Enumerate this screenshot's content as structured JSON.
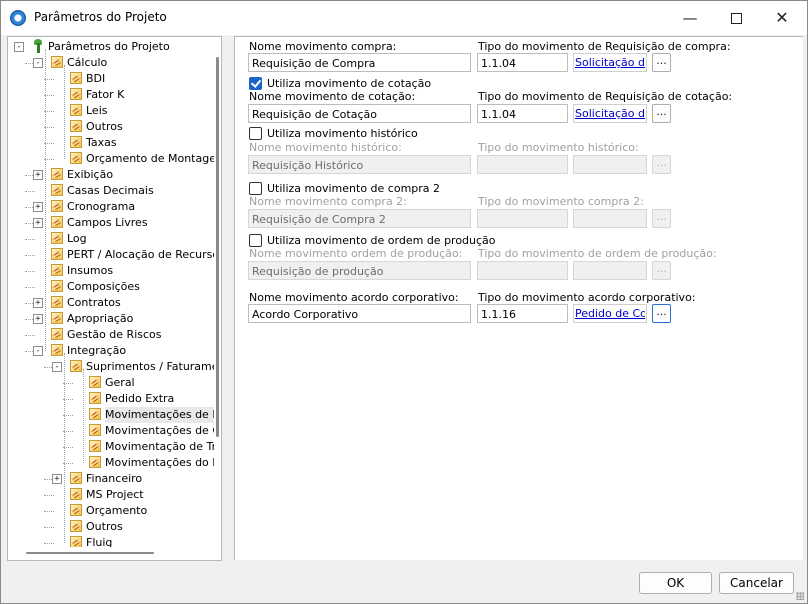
{
  "window": {
    "title": "Parâmetros do Projeto",
    "minimize": "—",
    "close": "✕"
  },
  "tree": {
    "items": [
      {
        "label": "Parâmetros do Projeto",
        "level": 0,
        "expander": "-",
        "icon": "root-icon"
      },
      {
        "label": "Cálculo",
        "level": 1,
        "expander": "-",
        "icon": "folder-icon"
      },
      {
        "label": "BDI",
        "level": 2,
        "expander": "",
        "icon": "folder-icon"
      },
      {
        "label": "Fator K",
        "level": 2,
        "expander": "",
        "icon": "folder-icon"
      },
      {
        "label": "Leis",
        "level": 2,
        "expander": "",
        "icon": "folder-icon"
      },
      {
        "label": "Outros",
        "level": 2,
        "expander": "",
        "icon": "folder-icon"
      },
      {
        "label": "Taxas",
        "level": 2,
        "expander": "",
        "icon": "folder-icon"
      },
      {
        "label": "Orçamento de Montagem",
        "level": 2,
        "expander": "",
        "icon": "folder-icon"
      },
      {
        "label": "Exibição",
        "level": 1,
        "expander": "+",
        "icon": "folder-icon"
      },
      {
        "label": "Casas Decimais",
        "level": 1,
        "expander": "",
        "icon": "folder-icon"
      },
      {
        "label": "Cronograma",
        "level": 1,
        "expander": "+",
        "icon": "folder-icon"
      },
      {
        "label": "Campos Livres",
        "level": 1,
        "expander": "+",
        "icon": "folder-icon"
      },
      {
        "label": "Log",
        "level": 1,
        "expander": "",
        "icon": "folder-icon"
      },
      {
        "label": "PERT / Alocação de Recursos",
        "level": 1,
        "expander": "",
        "icon": "folder-icon"
      },
      {
        "label": "Insumos",
        "level": 1,
        "expander": "",
        "icon": "folder-icon"
      },
      {
        "label": "Composições",
        "level": 1,
        "expander": "",
        "icon": "folder-icon"
      },
      {
        "label": "Contratos",
        "level": 1,
        "expander": "+",
        "icon": "folder-icon"
      },
      {
        "label": "Apropriação",
        "level": 1,
        "expander": "+",
        "icon": "folder-icon"
      },
      {
        "label": "Gestão de Riscos",
        "level": 1,
        "expander": "",
        "icon": "folder-icon"
      },
      {
        "label": "Integração",
        "level": 1,
        "expander": "-",
        "icon": "folder-icon"
      },
      {
        "label": "Suprimentos / Faturamento",
        "level": 2,
        "expander": "-",
        "icon": "folder-icon"
      },
      {
        "label": "Geral",
        "level": 3,
        "expander": "",
        "icon": "folder-icon"
      },
      {
        "label": "Pedido Extra",
        "level": 3,
        "expander": "",
        "icon": "folder-icon"
      },
      {
        "label": "Movimentações de Pedidos",
        "level": 3,
        "expander": "",
        "icon": "folder-icon",
        "selected": true
      },
      {
        "label": "Movimentações de Compras",
        "level": 3,
        "expander": "",
        "icon": "folder-icon"
      },
      {
        "label": "Movimentação de Transferência",
        "level": 3,
        "expander": "",
        "icon": "folder-icon"
      },
      {
        "label": "Movimentações do Bem",
        "level": 3,
        "expander": "",
        "icon": "folder-icon"
      },
      {
        "label": "Financeiro",
        "level": 2,
        "expander": "+",
        "icon": "folder-icon"
      },
      {
        "label": "MS Project",
        "level": 2,
        "expander": "",
        "icon": "folder-icon"
      },
      {
        "label": "Orçamento",
        "level": 2,
        "expander": "",
        "icon": "folder-icon"
      },
      {
        "label": "Outros",
        "level": 2,
        "expander": "",
        "icon": "folder-icon"
      },
      {
        "label": "Fluig",
        "level": 2,
        "expander": "",
        "icon": "folder-icon"
      }
    ]
  },
  "form": {
    "ellipsis": "...",
    "compra": {
      "name_label": "Nome movimento compra:",
      "name_value": "Requisição de Compra",
      "type_label": "Tipo do movimento de Requisição de compra:",
      "type_value": "1.1.04",
      "type_link": "Solicitação de Compra"
    },
    "cotacao": {
      "check_label": "Utiliza movimento de cotação",
      "checked": true,
      "name_label": "Nome movimento de cotação:",
      "name_value": "Requisição de Cotação",
      "type_label": "Tipo do movimento de Requisição de cotação:",
      "type_value": "1.1.04",
      "type_link": "Solicitação de Compra"
    },
    "historico": {
      "check_label": "Utiliza movimento histórico",
      "checked": false,
      "name_label": "Nome movimento histórico:",
      "name_value": "Requisição Histórico",
      "type_label": "Tipo do movimento histórico:",
      "type_value": "",
      "type_link": ""
    },
    "compra2": {
      "check_label": "Utiliza movimento de compra 2",
      "checked": false,
      "name_label": "Nome movimento compra 2:",
      "name_value": "Requisição de Compra 2",
      "type_label": "Tipo do movimento compra 2:",
      "type_value": "",
      "type_link": ""
    },
    "producao": {
      "check_label": "Utiliza movimento de ordem de produção",
      "checked": false,
      "name_label": "Nome movimento ordem de produção:",
      "name_value": "Requisição de produção",
      "type_label": "Tipo do movimento de ordem de produção:",
      "type_value": "",
      "type_link": ""
    },
    "corporativo": {
      "name_label": "Nome movimento acordo corporativo:",
      "name_value": "Acordo Corporativo",
      "type_label": "Tipo do movimento acordo corporativo:",
      "type_value": "1.1.16",
      "type_link": "Pedido de Compra"
    }
  },
  "footer": {
    "ok_label": "OK",
    "cancel_label": "Cancelar"
  }
}
